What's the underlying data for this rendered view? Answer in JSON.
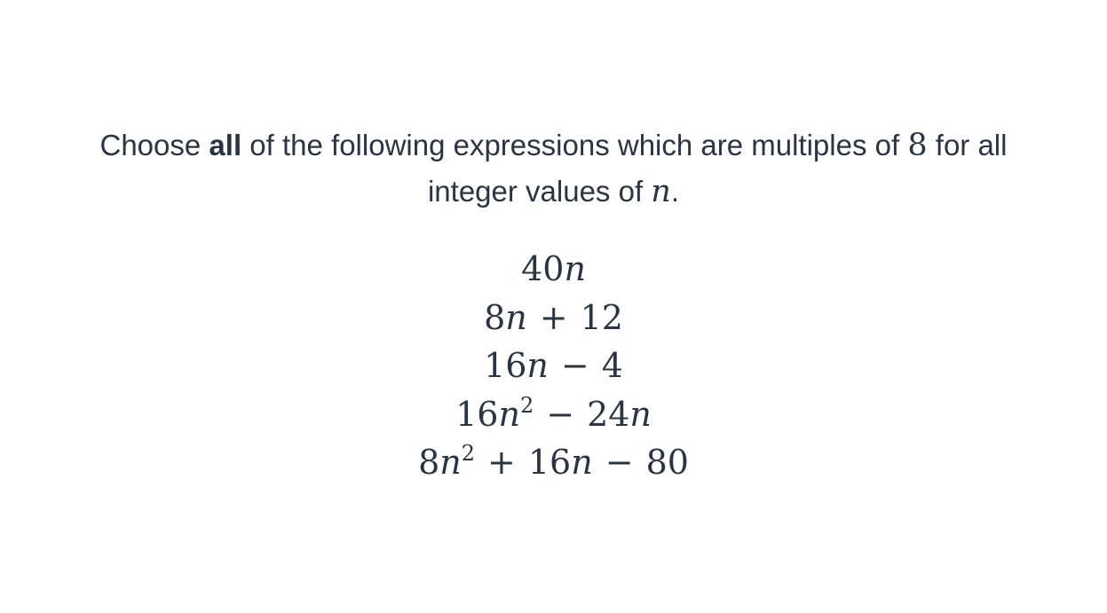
{
  "question": {
    "prefix": "Choose ",
    "emphasis": "all",
    "middle": " of the following expressions which are multiples of ",
    "number": "8",
    "suffix": " for all",
    "line2_prefix": "integer values of ",
    "variable": "n",
    "line2_suffix": "."
  },
  "expressions": [
    {
      "parts": [
        "40",
        "n"
      ]
    },
    {
      "parts": [
        "8",
        "n",
        "+",
        "12"
      ]
    },
    {
      "parts": [
        "16",
        "n",
        "−",
        "4"
      ]
    },
    {
      "parts": [
        "16",
        "n",
        "2",
        "−",
        "24",
        "n"
      ]
    },
    {
      "parts": [
        "8",
        "n",
        "2",
        "+",
        "16",
        "n",
        "−",
        "80"
      ]
    }
  ]
}
